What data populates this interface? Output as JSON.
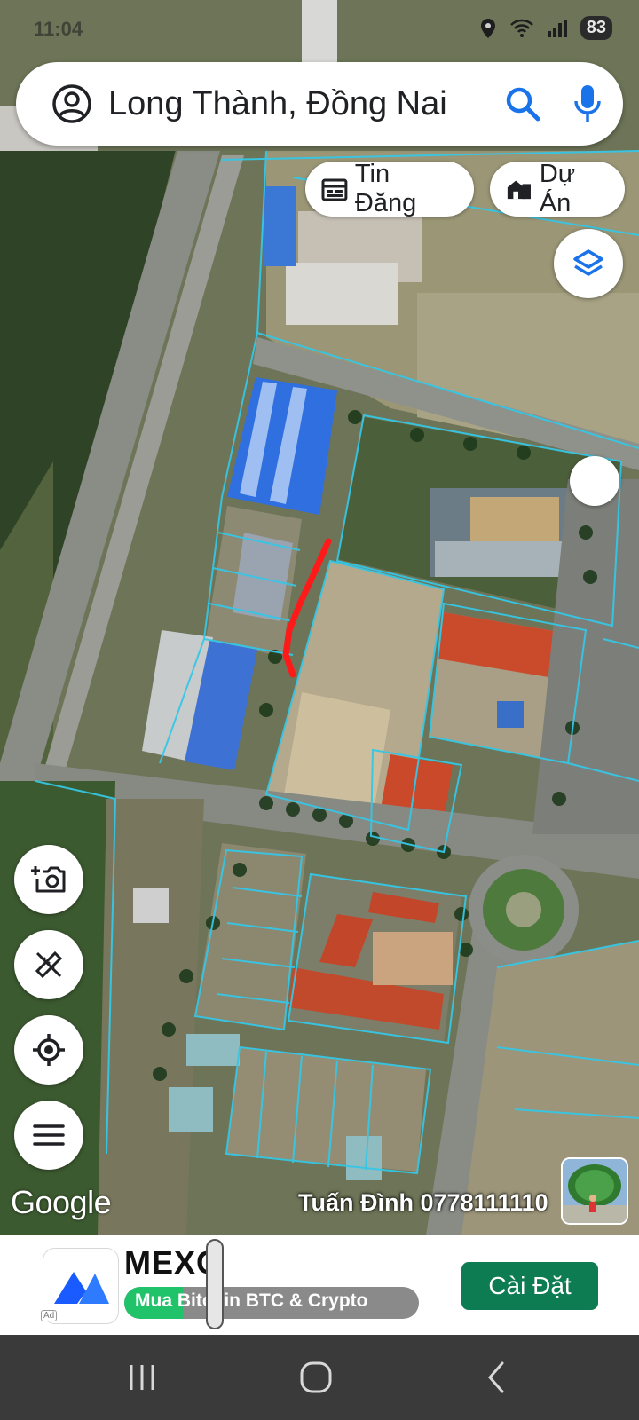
{
  "status_bar": {
    "time": "11:04",
    "battery": "83"
  },
  "search": {
    "query": "Long Thành, Đồng Nai"
  },
  "chips": [
    {
      "label": "Tin Đăng",
      "icon": "calendar-icon"
    },
    {
      "label": "Dự Án",
      "icon": "buildings-icon"
    }
  ],
  "map": {
    "attribution": "Google",
    "watermark": "Tuấn Đình 0778111110",
    "parcel_line_color": "#35c7e6",
    "highlight_color": "#ff1a1a"
  },
  "controls": {
    "left": [
      "camera-add-icon",
      "ruler-pencil-icon",
      "my-location-icon",
      "menu-icon"
    ],
    "right": [
      "layers-icon",
      "compass-dot"
    ]
  },
  "ad": {
    "brand": "MEXC",
    "tagline": "Mua Bitcoin BTC & Crypto",
    "badge": "Ad",
    "install_label": "Cài Đặt",
    "progress_percent": 20,
    "accent": "#0e7c52"
  },
  "nav": {
    "items": [
      "recent-apps-icon",
      "home-icon",
      "back-icon"
    ]
  }
}
